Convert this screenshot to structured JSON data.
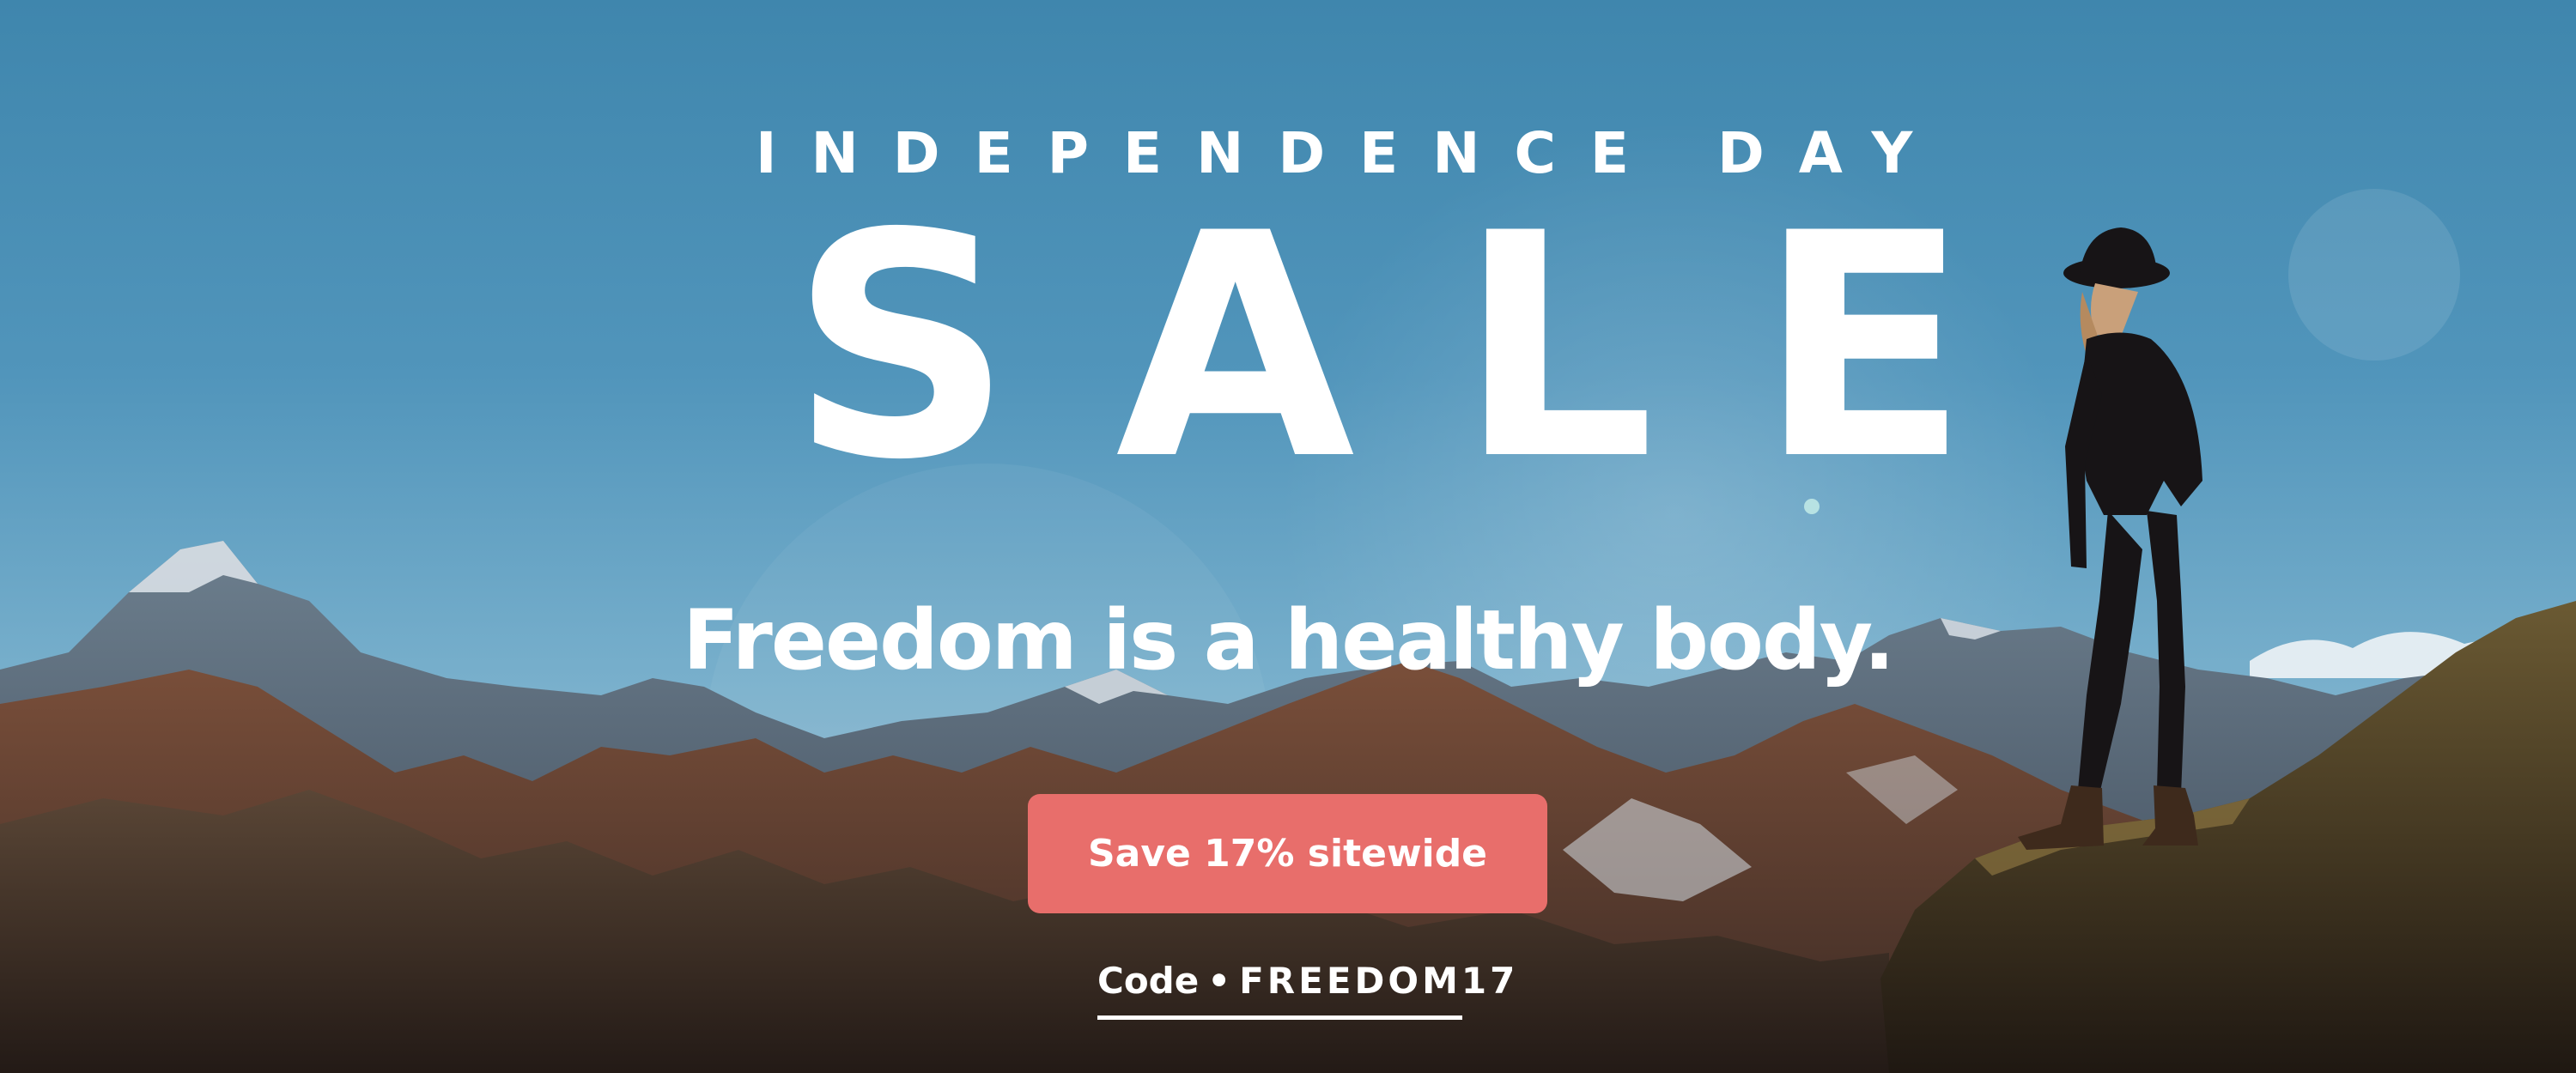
{
  "hero": {
    "eyebrow": "INDEPENDENCE DAY",
    "headline": "SALE",
    "tagline": "Freedom is a healthy body.",
    "cta_label": "Save 17% sitewide",
    "promo_label": "Code",
    "promo_separator": "•",
    "promo_code": "FREEDOM17"
  },
  "colors": {
    "sky": "#4a8fb8",
    "cta_background": "#e86e6b",
    "text": "#ffffff",
    "mountain_rock": "#5a3a2c"
  },
  "image": {
    "subject": "hiker-on-mountain-ridge",
    "background": "mountain-range-with-snow"
  }
}
